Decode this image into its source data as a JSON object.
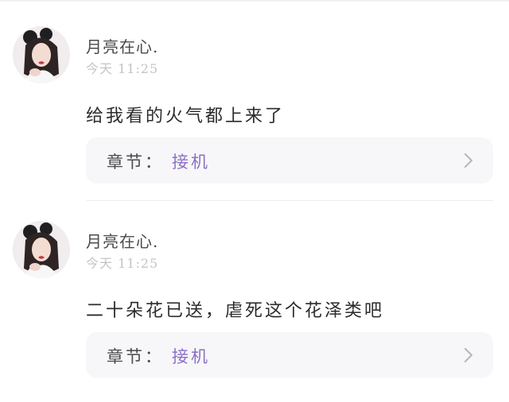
{
  "comments": [
    {
      "username": "月亮在心.",
      "time": "今天 11:25",
      "content": "给我看的火气都上来了",
      "chapter_label": "章节：",
      "chapter_value": "接机"
    },
    {
      "username": "月亮在心.",
      "time": "今天 11:25",
      "content": "二十朵花已送，虐死这个花泽类吧",
      "chapter_label": "章节：",
      "chapter_value": "接机"
    }
  ],
  "colors": {
    "chapter_accent": "#8b6fc6",
    "chapter_bg": "#f7f7f9"
  },
  "icons": [
    "avatar",
    "chevron-right-icon"
  ]
}
